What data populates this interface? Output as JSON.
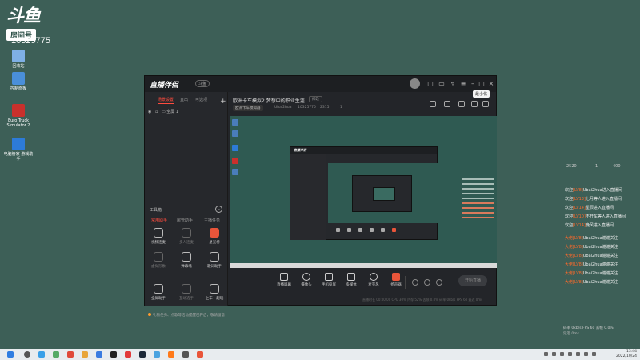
{
  "watermark": {
    "logo_text": "斗鱼",
    "tag": "房间号",
    "room_number": "10325775"
  },
  "desktop_icons": [
    {
      "label": "回收站",
      "color": "#7fb0e6"
    },
    {
      "label": "控制面板",
      "color": "#4a8fd9"
    },
    {
      "label": "Euro Truck Simulator 2",
      "color": "#c9302c"
    },
    {
      "label": "电脑管家-游戏助手",
      "color": "#2d7bd8"
    }
  ],
  "app": {
    "brand": "直播伴侣",
    "brand_tag": "斗鱼",
    "tooltip": "最小化",
    "sidebar_tabs": [
      "场景设置",
      "直出",
      "可选项"
    ],
    "scene_item": "全屏 1",
    "toolbox_title": "工具箱",
    "tool_tabs": [
      "常用助手",
      "房管助手",
      "主播任务"
    ],
    "tools": [
      {
        "label": "视频连麦",
        "style": "normal"
      },
      {
        "label": "多人连麦",
        "style": "dim"
      },
      {
        "label": "星光榜",
        "style": "red"
      },
      {
        "label": "虚拟形象",
        "style": "dim"
      },
      {
        "label": "弹幕墙",
        "style": "normal"
      },
      {
        "label": "歌词助手",
        "style": "normal"
      },
      {
        "label": "全屏助手",
        "style": "normal"
      },
      {
        "label": "互动选手",
        "style": "dim"
      },
      {
        "label": "上车一起玩",
        "style": "normal"
      }
    ],
    "notice": "礼物任务、点歌等活动提醒已开启，敬请留意",
    "stream_title": "欧洲卡车模拟2 梦想中的职业生涯",
    "edit_label": "修改",
    "category": "欧洲卡车模拟器",
    "streamer": "Ubai2hua",
    "room_id": "10325775",
    "heat": "2315",
    "viewers": "1",
    "controls": [
      "直播屏幕",
      "摄像头",
      "手机投屏",
      "多媒体",
      "麦克风",
      "扬声器"
    ],
    "start_label": "开始直播",
    "status": "直播时长 00:00:00   CPU 30%   内存 52%   丢帧 0.0%   码率 0kb/s   FPS 60   延迟 0ms"
  },
  "chat": {
    "stats": [
      "2520",
      "1",
      "400"
    ],
    "lines": [
      {
        "lv": "欢迎",
        "level": "[LV8]",
        "user": "Ubai2hua",
        "text": "进入直播间"
      },
      {
        "lv": "欢迎",
        "level": "[LV13]",
        "user": "七月",
        "text": "等人进入直播间"
      },
      {
        "lv": "欢迎",
        "level": "[LV14]",
        "user": "星辰",
        "text": "进入直播间"
      },
      {
        "lv": "欢迎",
        "level": "[LV10]",
        "user": "不开车",
        "text": "等人进入直播间"
      },
      {
        "lv": "欢迎",
        "level": "[LV14]",
        "user": "晚风",
        "text": "进入直播间"
      },
      {
        "lv": "大佬",
        "level": "[LV8]",
        "user": "Ubai2hua",
        "text": "谢谢关注"
      },
      {
        "lv": "大佬",
        "level": "[LV8]",
        "user": "Ubai2hua",
        "text": "谢谢关注"
      },
      {
        "lv": "大佬",
        "level": "[LV8]",
        "user": "Ubai2hua",
        "text": "谢谢关注"
      },
      {
        "lv": "大佬",
        "level": "[LV8]",
        "user": "Ubai2hua",
        "text": "谢谢关注"
      },
      {
        "lv": "大佬",
        "level": "[LV8]",
        "user": "Ubai2hua",
        "text": "谢谢关注"
      },
      {
        "lv": "大佬",
        "level": "[LV8]",
        "user": "Ubai2hua",
        "text": "谢谢关注"
      }
    ],
    "footer": "码率 0kb/s  FPS 60  丢帧 0.0%",
    "footer2": "延迟 0ms"
  },
  "taskbar": {
    "time": "13:44",
    "date": "2022/10/24"
  },
  "colors": {
    "accent": "#ff4b3e",
    "desktop": "#3d5f57",
    "window": "#232529"
  }
}
